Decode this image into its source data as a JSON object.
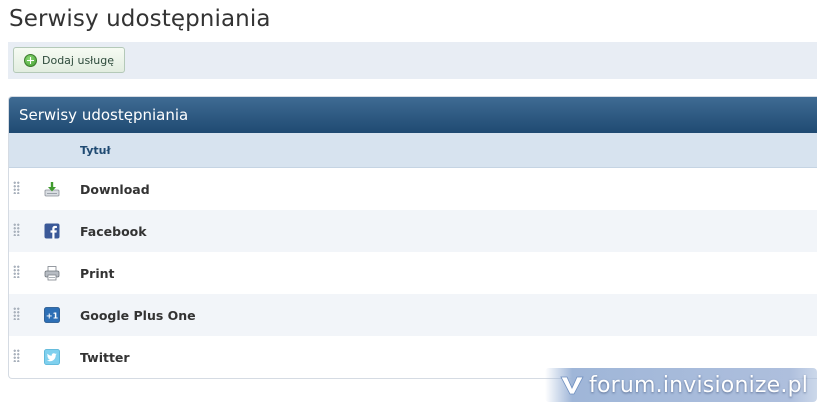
{
  "page": {
    "title": "Serwisy udostępniania"
  },
  "toolbar": {
    "add_label": "Dodaj usługę",
    "add_icon": "plus-circle-icon"
  },
  "panel": {
    "title": "Serwisy udostępniania",
    "column_title": "Tytuł",
    "rows": [
      {
        "label": "Download",
        "icon": "download-icon"
      },
      {
        "label": "Facebook",
        "icon": "facebook-icon"
      },
      {
        "label": "Print",
        "icon": "printer-icon"
      },
      {
        "label": "Google Plus One",
        "icon": "google-plus-one-icon"
      },
      {
        "label": "Twitter",
        "icon": "twitter-icon"
      }
    ]
  },
  "watermark": {
    "text": "forum.invisionize.pl"
  },
  "colors": {
    "header": "#2b5680",
    "column_header": "#d7e3ef",
    "alt_row": "#f2f5f9",
    "toolbar": "#e8edf4"
  }
}
